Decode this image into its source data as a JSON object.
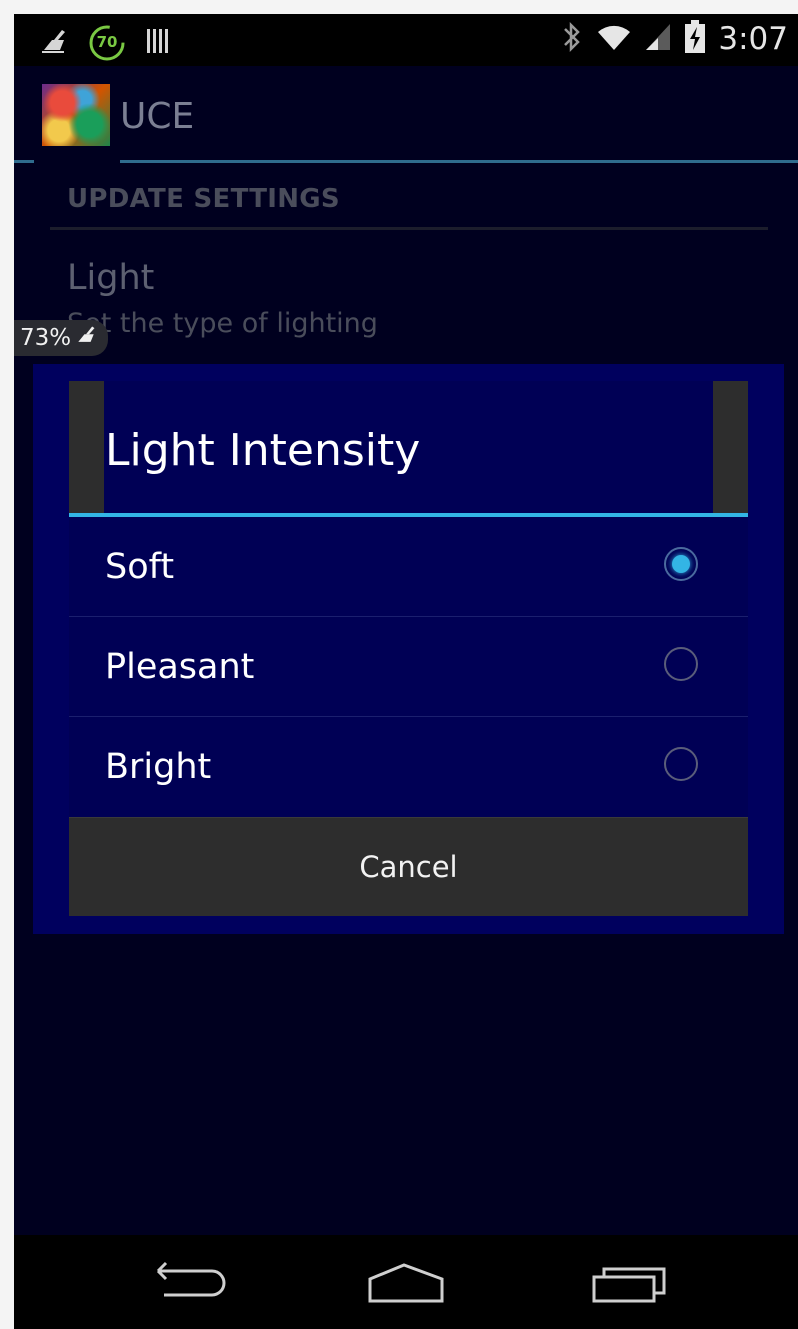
{
  "status_bar": {
    "time": "3:07",
    "notification_badge": "70",
    "icons": [
      "cleaner-icon",
      "battery-saver-icon",
      "barcode-icon",
      "bluetooth-icon",
      "wifi-icon",
      "signal-icon",
      "battery-charging-icon"
    ]
  },
  "action_bar": {
    "title": "UCE",
    "icon": "app-logo-icon"
  },
  "preferences": {
    "category": "UPDATE SETTINGS",
    "item_title": "Light",
    "item_summary": "Set the type of lighting"
  },
  "overlay": {
    "battery_percent": "73%"
  },
  "dialog": {
    "title": "Light Intensity",
    "options": [
      {
        "label": "Soft",
        "selected": true
      },
      {
        "label": "Pleasant",
        "selected": false
      },
      {
        "label": "Bright",
        "selected": false
      }
    ],
    "cancel_label": "Cancel"
  },
  "nav_bar": {
    "icons": [
      "back-icon",
      "home-icon",
      "recents-icon"
    ]
  },
  "colors": {
    "accent": "#33b5e5",
    "dialog_bg": "#000055",
    "screen_bg": "#00001f"
  }
}
